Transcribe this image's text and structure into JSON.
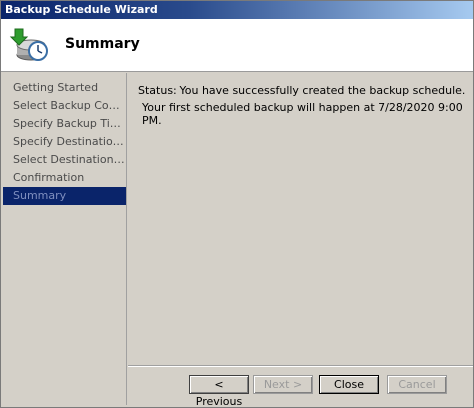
{
  "window": {
    "title": "Backup Schedule Wizard"
  },
  "header": {
    "title": "Summary",
    "icon": "backup-clock-icon"
  },
  "sidebar": {
    "steps": [
      {
        "label": "Getting Started"
      },
      {
        "label": "Select Backup Configur..."
      },
      {
        "label": "Specify Backup Time"
      },
      {
        "label": "Specify Destination Type"
      },
      {
        "label": "Select Destination Volume"
      },
      {
        "label": "Confirmation"
      },
      {
        "label": "Summary",
        "active": true
      }
    ]
  },
  "content": {
    "status_label": "Status:",
    "status_text": "You have successfully created the backup schedule.",
    "next_backup_text": "Your first scheduled backup will happen at 7/28/2020 9:00 PM."
  },
  "buttons": {
    "previous": "< Previous",
    "next": "Next >",
    "close": "Close",
    "cancel": "Cancel"
  },
  "colors": {
    "title_bar": "#0a246a",
    "selected_step": "#0a246a",
    "dialog_bg": "#d4d0c8"
  }
}
